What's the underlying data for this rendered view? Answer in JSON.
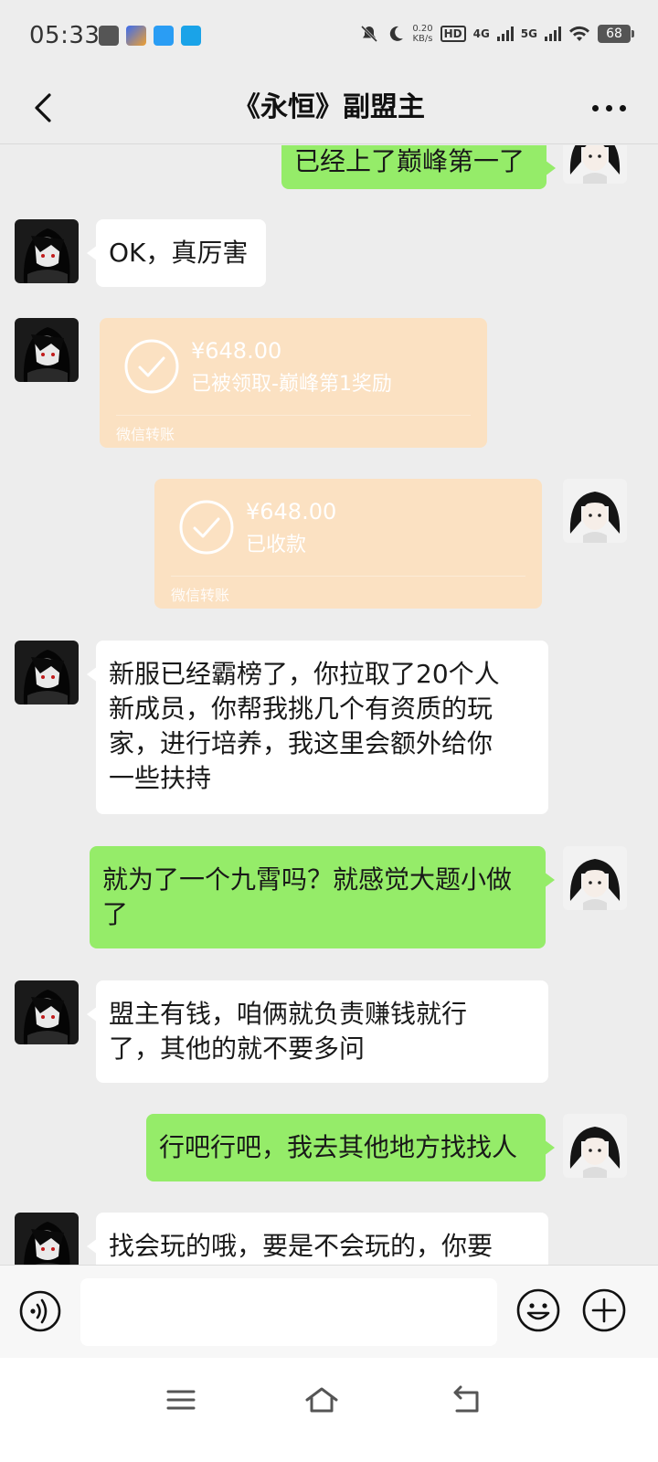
{
  "status_bar": {
    "time": "05:33",
    "net_speed_value": "0.20",
    "net_speed_unit": "KB/s",
    "hd_label": "HD",
    "sig1_label": "4G",
    "sig2_label": "5G",
    "battery": "68",
    "icons": [
      "notification-off-icon",
      "moon-icon",
      "hd-icon",
      "signal-4g-icon",
      "signal-5g-icon",
      "wifi-icon",
      "battery-icon"
    ]
  },
  "header": {
    "title": "《永恒》副盟主",
    "back_icon": "chevron-left-icon",
    "more_icon": "more-icon"
  },
  "messages": [
    {
      "side": "right",
      "type": "text",
      "text": "已经上了巅峰第一了"
    },
    {
      "side": "left",
      "type": "text",
      "text": "OK，真厉害"
    },
    {
      "side": "left",
      "type": "transfer",
      "amount": "¥648.00",
      "state": "已被领取-巅峰第1奖励",
      "label": "微信转账"
    },
    {
      "side": "right",
      "type": "transfer",
      "amount": "¥648.00",
      "state": "已收款",
      "label": "微信转账"
    },
    {
      "side": "left",
      "type": "text",
      "lines": [
        "新服已经霸榜了，你拉取了20个人",
        "新成员，你帮我挑几个有资质的玩",
        "家，进行培养，我这里会额外给你",
        "一些扶持"
      ]
    },
    {
      "side": "right",
      "type": "text",
      "lines": [
        "就为了一个九霄吗？就感觉大题小做",
        "了"
      ]
    },
    {
      "side": "left",
      "type": "text",
      "lines": [
        "盟主有钱，咱俩就负责赚钱就行",
        "了，其他的就不要多问"
      ]
    },
    {
      "side": "right",
      "type": "text",
      "text": "行吧行吧，我去其他地方找找人"
    },
    {
      "side": "left",
      "type": "text",
      "text": "找会玩的哦，要是不会玩的，你要"
    }
  ],
  "input_bar": {
    "value": "",
    "voice_icon": "voice-icon",
    "emoji_icon": "emoji-icon",
    "plus_icon": "plus-icon"
  },
  "nav_bar": {
    "icons": [
      "menu-icon",
      "home-icon",
      "back-icon"
    ]
  },
  "colors": {
    "background": "#ededed",
    "my_bubble": "#95ec69",
    "their_bubble": "#ffffff",
    "transfer_card": "#fbe1c2"
  }
}
